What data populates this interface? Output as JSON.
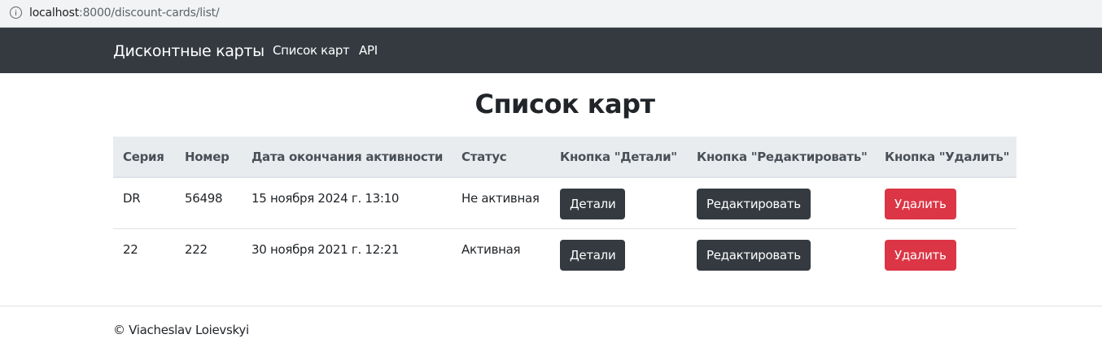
{
  "browser": {
    "url_host": "localhost",
    "url_rest": ":8000/discount-cards/list/"
  },
  "navbar": {
    "brand": "Дисконтные карты",
    "links": [
      "Список карт",
      "API"
    ]
  },
  "page": {
    "title": "Список карт"
  },
  "table": {
    "headers": [
      "Серия",
      "Номер",
      "Дата окончания активности",
      "Статус",
      "Кнопка \"Детали\"",
      "Кнопка \"Редактировать\"",
      "Кнопка \"Удалить\""
    ],
    "rows": [
      {
        "series": "DR",
        "number": "56498",
        "expires": "15 ноября 2024 г. 13:10",
        "status": "Не активная",
        "details_label": "Детали",
        "edit_label": "Редактировать",
        "delete_label": "Удалить"
      },
      {
        "series": "22",
        "number": "222",
        "expires": "30 ноября 2021 г. 12:21",
        "status": "Активная",
        "details_label": "Детали",
        "edit_label": "Редактировать",
        "delete_label": "Удалить"
      }
    ]
  },
  "footer": {
    "text": "© Viacheslav Loievskyi"
  },
  "colors": {
    "navbar_bg": "#343a40",
    "header_bg": "#e9ecef",
    "btn_dark": "#343a40",
    "btn_danger": "#dc3545"
  }
}
